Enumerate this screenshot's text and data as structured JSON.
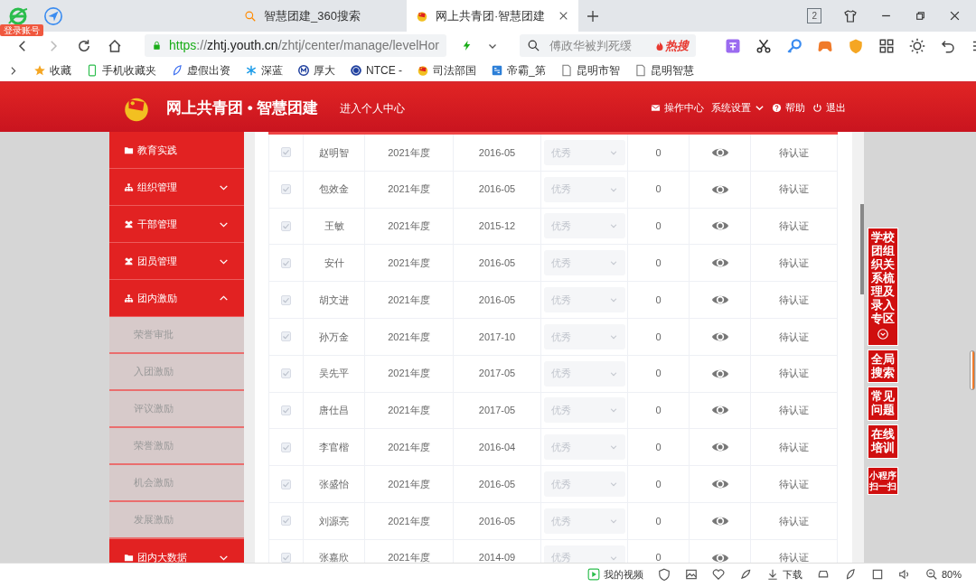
{
  "browser": {
    "login_badge": "登录账号",
    "tabs": [
      {
        "title": "智慧团建_360搜索",
        "selected": false
      },
      {
        "title": "网上共青团·智慧团建",
        "selected": true
      }
    ],
    "tab_count": "2",
    "address": [
      {
        "text": "https",
        "kind": "scheme"
      },
      {
        "text": "://",
        "kind": "sep"
      },
      {
        "text": "zhtj.youth.cn",
        "kind": "host"
      },
      {
        "text": "/zhtj/center/manage/levelHor",
        "kind": "path"
      }
    ],
    "search": {
      "placeholder": "傅政华被判死缓",
      "hot": "热搜"
    },
    "bookmarks": [
      "收藏",
      "手机收藏夹",
      "虚假出资",
      "深蓝",
      "厚大",
      "NTCE -",
      "司法部国",
      "帝霸_第",
      "昆明市智",
      "昆明智慧"
    ]
  },
  "header": {
    "title": "网上共青团 • 智慧团建",
    "personal_link": "进入个人中心",
    "nav": [
      "操作中心",
      "系统设置",
      "帮助",
      "退出"
    ]
  },
  "sidebar": {
    "items": [
      {
        "label": "教育实践",
        "kind": "link"
      },
      {
        "label": "组织管理",
        "kind": "group",
        "expanded": false
      },
      {
        "label": "干部管理",
        "kind": "group",
        "expanded": false
      },
      {
        "label": "团员管理",
        "kind": "group",
        "expanded": false
      },
      {
        "label": "团内激励",
        "kind": "group",
        "expanded": true,
        "children": [
          {
            "label": "荣誉审批"
          },
          {
            "label": "入团激励"
          },
          {
            "label": "评议激励"
          },
          {
            "label": "荣誉激励"
          },
          {
            "label": "机会激励"
          },
          {
            "label": "发展激励"
          }
        ]
      },
      {
        "label": "团内大数据",
        "kind": "group",
        "expanded": false
      }
    ]
  },
  "table": {
    "rows": [
      {
        "checked": true,
        "name": "赵明智",
        "year": "2021年度",
        "date": "2016-05",
        "rating": "优秀",
        "count": "0",
        "status": "待认证"
      },
      {
        "checked": true,
        "name": "包效金",
        "year": "2021年度",
        "date": "2016-05",
        "rating": "优秀",
        "count": "0",
        "status": "待认证"
      },
      {
        "checked": true,
        "name": "王敏",
        "year": "2021年度",
        "date": "2015-12",
        "rating": "优秀",
        "count": "0",
        "status": "待认证"
      },
      {
        "checked": true,
        "name": "安什",
        "year": "2021年度",
        "date": "2016-05",
        "rating": "优秀",
        "count": "0",
        "status": "待认证"
      },
      {
        "checked": true,
        "name": "胡文进",
        "year": "2021年度",
        "date": "2016-05",
        "rating": "优秀",
        "count": "0",
        "status": "待认证"
      },
      {
        "checked": true,
        "name": "孙万金",
        "year": "2021年度",
        "date": "2017-10",
        "rating": "优秀",
        "count": "0",
        "status": "待认证"
      },
      {
        "checked": true,
        "name": "吴先平",
        "year": "2021年度",
        "date": "2017-05",
        "rating": "优秀",
        "count": "0",
        "status": "待认证"
      },
      {
        "checked": true,
        "name": "唐仕昌",
        "year": "2021年度",
        "date": "2017-05",
        "rating": "优秀",
        "count": "0",
        "status": "待认证"
      },
      {
        "checked": true,
        "name": "李官楷",
        "year": "2021年度",
        "date": "2016-04",
        "rating": "优秀",
        "count": "0",
        "status": "待认证"
      },
      {
        "checked": true,
        "name": "张盛怡",
        "year": "2021年度",
        "date": "2016-05",
        "rating": "优秀",
        "count": "0",
        "status": "待认证"
      },
      {
        "checked": true,
        "name": "刘源亮",
        "year": "2021年度",
        "date": "2016-05",
        "rating": "优秀",
        "count": "0",
        "status": "待认证"
      },
      {
        "checked": true,
        "name": "张嘉欣",
        "year": "2021年度",
        "date": "2014-09",
        "rating": "优秀",
        "count": "0",
        "status": "待认证"
      }
    ]
  },
  "float_buttons": [
    {
      "label": "学校团组织关系梳理及录入专区",
      "kind": "tall"
    },
    {
      "label": "全局搜索",
      "kind": "normal"
    },
    {
      "label": "常见问题",
      "kind": "normal"
    },
    {
      "label": "在线培训",
      "kind": "normal"
    },
    {
      "label": "小程序扫一扫",
      "kind": "small"
    }
  ],
  "status_bar": {
    "video": "我的视频",
    "download": "下载",
    "zoom": "80%"
  }
}
